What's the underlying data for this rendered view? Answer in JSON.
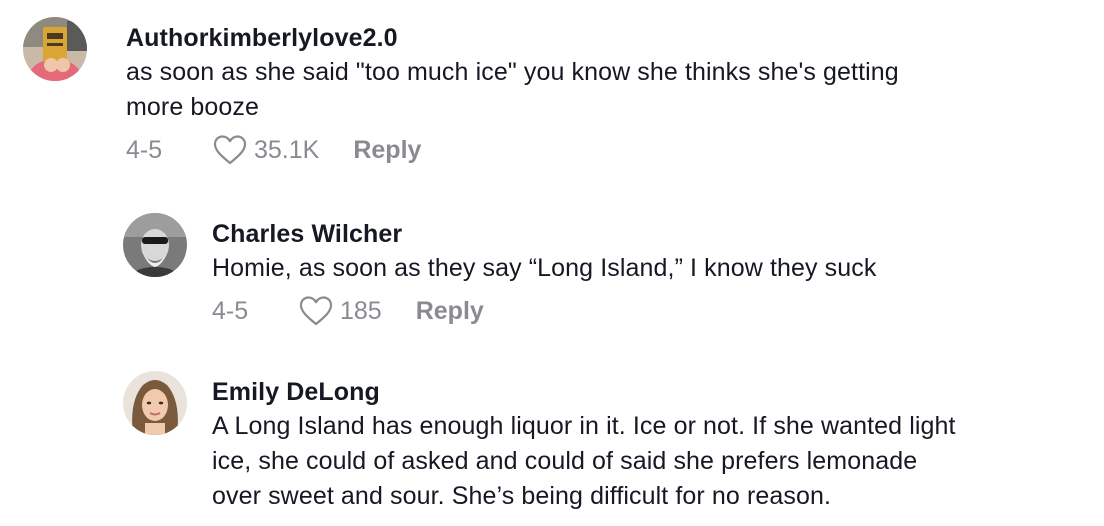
{
  "comments": [
    {
      "username": "Authorkimberlylove2.0",
      "text": "as soon as she said \"too much ice\" you know she thinks she's getting\nmore booze",
      "date": "4-5",
      "likes": "35.1K",
      "reply_label": "Reply"
    },
    {
      "username": "Charles Wilcher",
      "text": "Homie, as soon as they say “Long Island,” I know they suck",
      "date": "4-5",
      "likes": "185",
      "reply_label": "Reply"
    },
    {
      "username": "Emily DeLong",
      "text": "A Long Island has enough liquor in it. Ice or not. If she wanted light\nice, she could of asked and could of said she prefers lemonade\nover sweet and sour. She’s being difficult for no reason.",
      "date": "",
      "likes": "",
      "reply_label": ""
    }
  ],
  "colors": {
    "text": "#161823",
    "muted": "#8a8b91"
  }
}
